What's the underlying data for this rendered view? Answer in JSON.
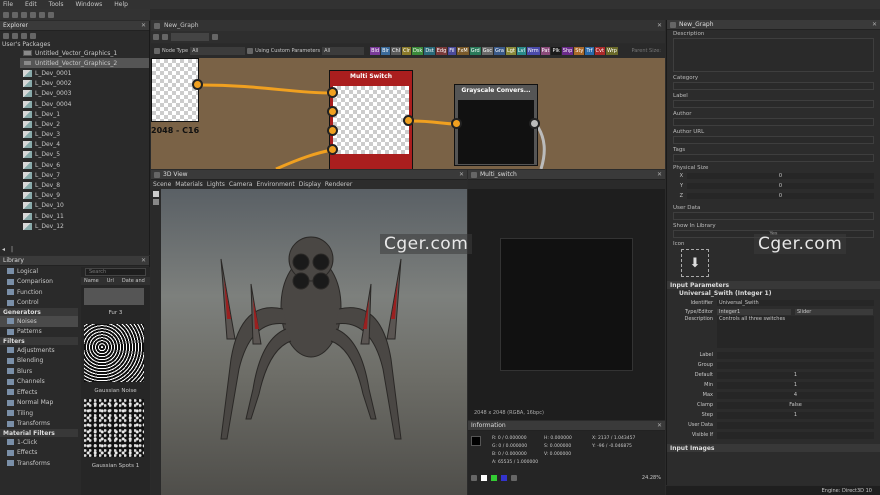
{
  "menu": [
    "File",
    "Edit",
    "Tools",
    "Windows",
    "Help"
  ],
  "explorer": {
    "title": "Explorer",
    "root": "User's Packages",
    "items": [
      "Untitled_Vector_Graphics_1",
      "Untitled_Vector_Graphics_2",
      "L_Dev_0001",
      "L_Dev_0002",
      "L_Dev_0003",
      "L_Dev_0004",
      "L_Dev_1",
      "L_Dev_2",
      "L_Dev_3",
      "L_Dev_4",
      "L_Dev_5",
      "L_Dev_6",
      "L_Dev_7",
      "L_Dev_8",
      "L_Dev_9",
      "L_Dev_10",
      "L_Dev_11",
      "L_Dev_12"
    ]
  },
  "graph": {
    "tab": "New_Graph",
    "node_type_label": "Node Type",
    "node_type_value": "All",
    "custom_params_label": "Using Custom Parameters",
    "custom_params_value": "All",
    "parent_size": "Parent Size:",
    "chips": [
      {
        "t": "Bld",
        "c": "#7a3a9a"
      },
      {
        "t": "Blr",
        "c": "#3a6a9a"
      },
      {
        "t": "Chl",
        "c": "#5a5a5a"
      },
      {
        "t": "Clr",
        "c": "#8a7a2a"
      },
      {
        "t": "Dsk",
        "c": "#3a8a3a"
      },
      {
        "t": "Dst",
        "c": "#2a6a7a"
      },
      {
        "t": "Edg",
        "c": "#7a3a3a"
      },
      {
        "t": "Fil",
        "c": "#4a4a9a"
      },
      {
        "t": "FxM",
        "c": "#7a5a2a"
      },
      {
        "t": "Grd",
        "c": "#2a7a5a"
      },
      {
        "t": "Gsc",
        "c": "#6a6a6a"
      },
      {
        "t": "Gra",
        "c": "#3a5a8a"
      },
      {
        "t": "Lgt",
        "c": "#8a8a3a"
      },
      {
        "t": "Lvl",
        "c": "#2a8a8a"
      },
      {
        "t": "Nrm",
        "c": "#4a4aaa"
      },
      {
        "t": "Pat",
        "c": "#8a4a7a"
      },
      {
        "t": "Plk",
        "c": "#1a1a1a"
      },
      {
        "t": "Shp",
        "c": "#6a2a8a"
      },
      {
        "t": "Sty",
        "c": "#aa6a2a"
      },
      {
        "t": "Trf",
        "c": "#2a6aaa"
      },
      {
        "t": "Cvt",
        "c": "#aa2a2a"
      },
      {
        "t": "Wrp",
        "c": "#6a6a2a"
      }
    ],
    "thumb_label": "2048 - C16",
    "node1": "Multi Switch",
    "node2": "Grayscale Convers..."
  },
  "view3d": {
    "title": "3D View",
    "menu": [
      "Scene",
      "Materials",
      "Lights",
      "Camera",
      "Environment",
      "Display",
      "Renderer"
    ]
  },
  "view2d": {
    "title": "Multi_switch",
    "status": "2048 x 2048 (RGBA, 16bpc)",
    "zoom": "24.28%"
  },
  "info": {
    "title": "Information",
    "cols": [
      [
        "R:   0  / 0.000000",
        "G:   0  / 0.000000",
        "B:   0  / 0.000000",
        "A: 65535 / 1.000000"
      ],
      [
        "H:  0.000000",
        "S:  0.000000",
        "V:  0.000000"
      ],
      [
        "X:  2137 / 1.043457",
        "Y:   -96 / -0.046875"
      ]
    ]
  },
  "library": {
    "title": "Library",
    "search_placeholder": "Search",
    "cols": [
      "Name",
      "Url",
      "Date and"
    ],
    "sections": [
      {
        "items": [
          "Logical",
          "Comparison",
          "Function",
          "Control"
        ]
      },
      {
        "name": "Generators",
        "items": [
          "Noises",
          "Patterns"
        ]
      },
      {
        "name": "Filters",
        "items": [
          "Adjustments",
          "Blending",
          "Blurs",
          "Channels",
          "Effects",
          "Normal Map",
          "Tiling",
          "Transforms"
        ]
      },
      {
        "name": "Material Filters",
        "items": [
          "1-Click",
          "Effects",
          "Transforms"
        ]
      }
    ],
    "thumbs": [
      "Fur 3",
      "Gaussian Noise",
      "Gaussian Spots 1"
    ]
  },
  "props": {
    "title": "New_Graph",
    "fields": [
      "Description",
      "Category",
      "Label",
      "Author",
      "Author URL",
      "Tags"
    ],
    "physical_size": "Physical Size",
    "xyz": [
      {
        "k": "X",
        "v": "0"
      },
      {
        "k": "Y",
        "v": "0"
      },
      {
        "k": "Z",
        "v": "0"
      }
    ],
    "user_data": "User Data",
    "show_in_library": "Show In Library",
    "show_value": "Yes",
    "icon": "Icon",
    "input_params": "Input Parameters",
    "param_name": "Universal_Swith (Integer 1)",
    "identifier_k": "Identifier",
    "identifier_v": "Universal_Swith",
    "type_k": "Type/Editor",
    "type_v": "Integer1",
    "editor_v": "Slider",
    "desc_k": "Description",
    "desc_v": "Controls all three switches",
    "rows": [
      {
        "k": "Label",
        "v": ""
      },
      {
        "k": "Group",
        "v": ""
      },
      {
        "k": "Default",
        "v": "1"
      },
      {
        "k": "Min",
        "v": "1"
      },
      {
        "k": "Max",
        "v": "4"
      },
      {
        "k": "Clamp",
        "v": "False"
      },
      {
        "k": "Step",
        "v": "1"
      },
      {
        "k": "User Data",
        "v": ""
      },
      {
        "k": "Visible If",
        "v": ""
      }
    ],
    "input_images": "Input Images"
  },
  "statusbar": {
    "engine": "Engine: Direct3D 10"
  },
  "watermark": "Cger.com"
}
